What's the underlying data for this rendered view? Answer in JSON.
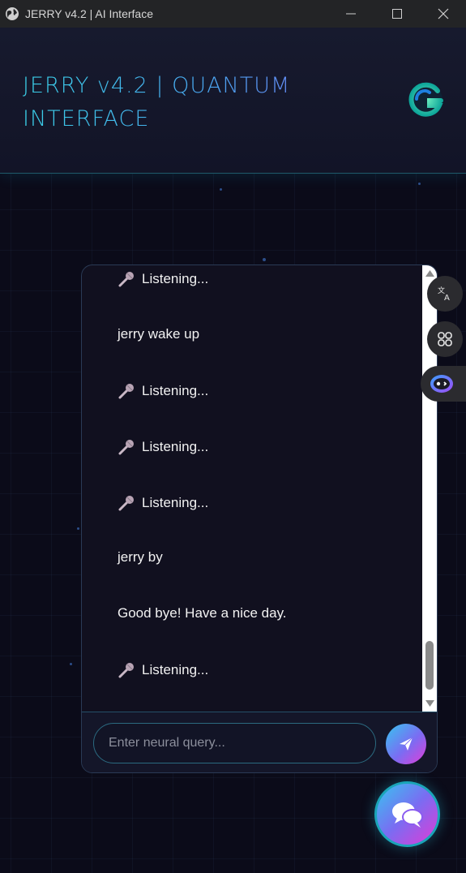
{
  "window": {
    "title": "JERRY v4.2 | AI Interface"
  },
  "header": {
    "title_line1": "JERRY v4.2 | QUANTUM",
    "title_line2": "INTERFACE"
  },
  "chat": {
    "messages": [
      {
        "text": "Listening...",
        "icon": "microphone-icon"
      },
      {
        "text": "jerry wake up"
      },
      {
        "text": "Listening...",
        "icon": "microphone-icon"
      },
      {
        "text": "Listening...",
        "icon": "microphone-icon"
      },
      {
        "text": "Listening...",
        "icon": "microphone-icon"
      },
      {
        "text": "jerry by"
      },
      {
        "text": "Good bye! Have a nice day."
      },
      {
        "text": "Listening...",
        "icon": "microphone-icon"
      }
    ],
    "input_placeholder": "Enter neural query..."
  },
  "colors": {
    "accent_cyan": "#33c6e6",
    "accent_purple": "#7b6cf2",
    "accent_pink": "#e23dd8",
    "background": "#0d0d1c"
  },
  "icons": {
    "send": "send-icon",
    "fab": "chat-bubbles-icon",
    "side_tools": [
      "translate-icon",
      "apps-icon",
      "assistant-icon"
    ]
  }
}
